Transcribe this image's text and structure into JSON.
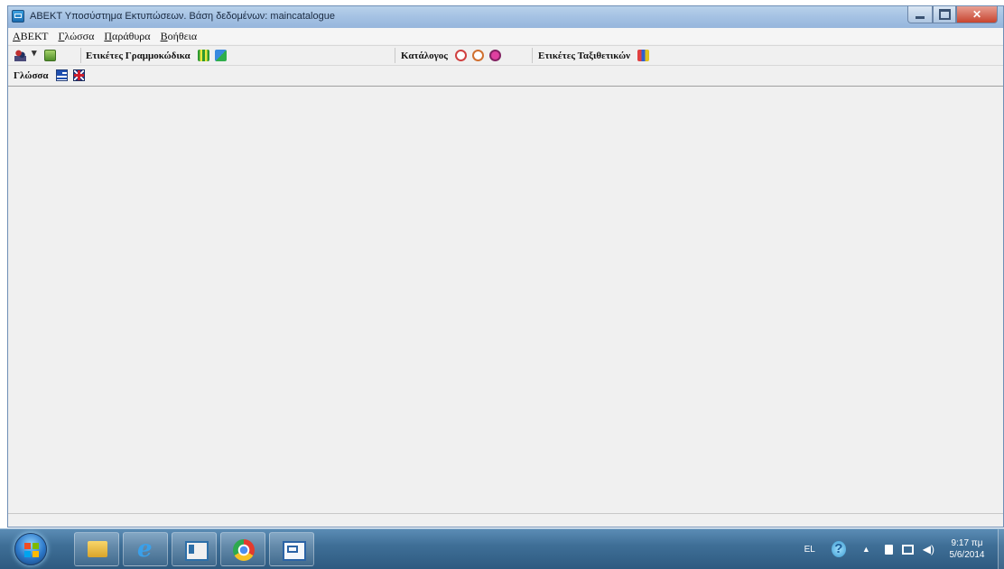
{
  "window": {
    "title": "ΑΒΕΚΤ Υποσύστημα Εκτυπώσεων. Βάση δεδομένων: maincatalogue"
  },
  "menu": {
    "items": [
      "ΑΒΕΚΤ",
      "Γλώσσα",
      "Παράθυρα",
      "Βοήθεια"
    ]
  },
  "toolbar": {
    "barcode_labels": "Ετικέτες Γραμμοκώδικα",
    "catalogue": "Κατάλογος",
    "shelfmark_labels": "Ετικέτες Ταξιθετικών",
    "language": "Γλώσσα"
  },
  "taskbar": {
    "language_indicator": "EL",
    "clock_time": "9:17 πμ",
    "clock_date": "5/6/2014",
    "apps": [
      "windows-explorer",
      "internet-explorer",
      "window-app",
      "google-chrome",
      "abekt-app"
    ]
  }
}
